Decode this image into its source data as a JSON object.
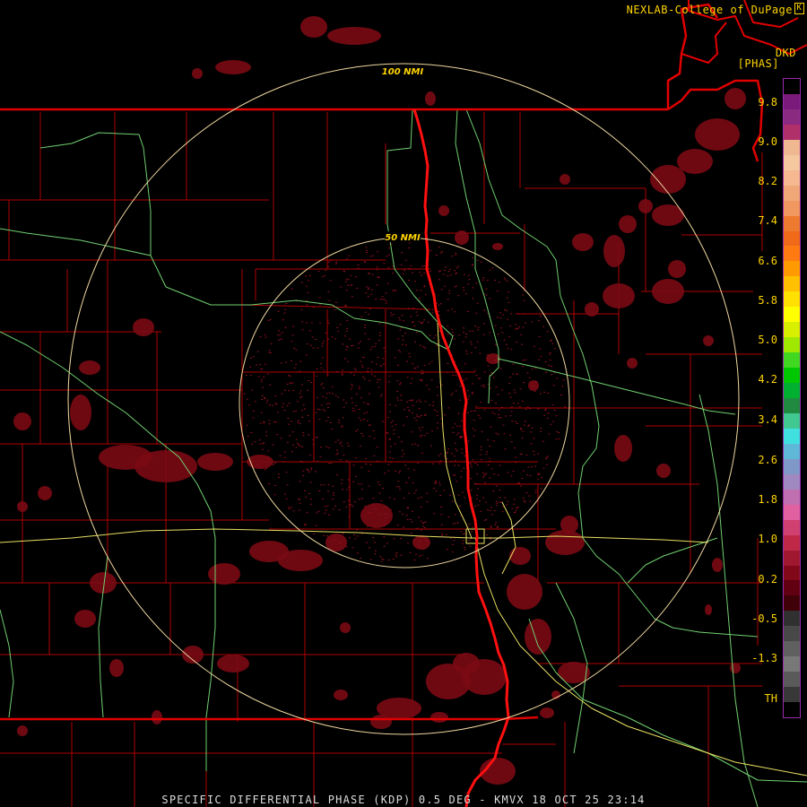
{
  "credit": "NEXLAB-College of DuPage",
  "credit_icon": "K",
  "product_code": "DKD",
  "units": "[PHAS]",
  "range_rings": [
    {
      "label": "100 NMI"
    },
    {
      "label": "50 NMI"
    }
  ],
  "legend": {
    "ticks": [
      "9.8",
      "9.0",
      "8.2",
      "7.4",
      "6.6",
      "5.8",
      "5.0",
      "4.2",
      "3.4",
      "2.6",
      "1.8",
      "1.0",
      "0.2",
      "-0.5",
      "-1.3",
      "TH"
    ],
    "colors": [
      "#000000",
      "#7a1a7a",
      "#8a2a80",
      "#b0306a",
      "#f0b890",
      "#f5c8a0",
      "#f5b890",
      "#f0a878",
      "#f09860",
      "#ee7a30",
      "#f06a1a",
      "#ff7a10",
      "#ff9a00",
      "#ffc000",
      "#ffe000",
      "#ffff00",
      "#d8f000",
      "#a0e800",
      "#40d820",
      "#00c800",
      "#00b030",
      "#208a40",
      "#40c890",
      "#40e0e0",
      "#60b8d8",
      "#8098c8",
      "#a088c0",
      "#c070b0",
      "#e060a0",
      "#d04070",
      "#c02848",
      "#a01830",
      "#800818",
      "#600010",
      "#400008",
      "#303030",
      "#484848",
      "#606060",
      "#787878",
      "#5a5a5a",
      "#383838",
      "#000000"
    ]
  },
  "map": {
    "state_line_color": "#e00000",
    "county_line_color": "#b00000",
    "river_color": "#ff1010",
    "highway_color": "#70d070",
    "road_color": "#e8e060",
    "ring_color": "#f0d8a0",
    "echo_color": "#7a0a14"
  },
  "caption": "SPECIFIC DIFFERENTIAL PHASE (KDP) 0.5 DEG - KMVX 18 OCT 25 23:14"
}
